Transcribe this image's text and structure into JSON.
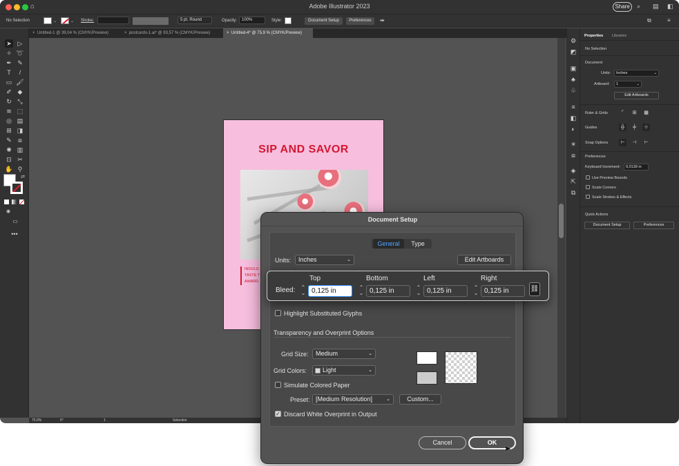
{
  "window": {
    "title": "Adobe Illustrator 2023",
    "share_label": "Share"
  },
  "control_bar": {
    "selection": "No Selection",
    "stroke_label": "Stroke:",
    "brush": "5 pt. Round",
    "opacity_label": "Opacity:",
    "opacity_value": "100%",
    "style_label": "Style:",
    "document_setup": "Document Setup",
    "preferences": "Preferences"
  },
  "doc_tabs": [
    {
      "label": "Untitled-1 @ 39,04 % (CMYK/Preview)"
    },
    {
      "label": "postcards-1.ai* @ 93,57 % (CMYK/Preview)"
    },
    {
      "label": "Untitled-4* @ 75,9 % (CMYK/Preview)"
    }
  ],
  "artboard": {
    "title": "SIP AND SAVOR",
    "text_lines": [
      "INDULG",
      "TASTE T",
      "AWARD"
    ]
  },
  "status_bar": {
    "zoom": "75,9%",
    "rotation": "0°",
    "page": "1",
    "tool": "Selection"
  },
  "properties": {
    "tabs": [
      "Properties",
      "Libraries"
    ],
    "no_selection": "No Selection",
    "document_heading": "Document",
    "units_label": "Units:",
    "units_value": "Inches",
    "artboard_label": "Artboard:",
    "artboard_value": "1",
    "edit_artboards": "Edit Artboards",
    "ruler_grids": "Ruler & Grids",
    "guides": "Guides",
    "snap_options": "Snap Options",
    "preferences_heading": "Preferences",
    "keyboard_increment_label": "Keyboard Increment:",
    "keyboard_increment_value": "0,0139 in",
    "use_preview_bounds": "Use Preview Bounds",
    "scale_corners": "Scale Corners",
    "scale_strokes": "Scale Strokes & Effects",
    "quick_actions": "Quick Actions",
    "qa_document_setup": "Document Setup",
    "qa_preferences": "Preferences"
  },
  "dialog": {
    "title": "Document Setup",
    "tab_general": "General",
    "tab_type": "Type",
    "units_label": "Units:",
    "units_value": "Inches",
    "edit_artboards": "Edit Artboards",
    "bleed_label": "Bleed:",
    "bleed": {
      "top_label": "Top",
      "top": "0,125 in",
      "bottom_label": "Bottom",
      "bottom": "0,125 in",
      "left_label": "Left",
      "left": "0,125 in",
      "right_label": "Right",
      "right": "0,125 in"
    },
    "highlight_glyphs": "Highlight Substituted Glyphs",
    "transparency_heading": "Transparency and Overprint Options",
    "grid_size_label": "Grid Size:",
    "grid_size_value": "Medium",
    "grid_colors_label": "Grid Colors:",
    "grid_colors_value": "Light",
    "simulate_paper": "Simulate Colored Paper",
    "preset_label": "Preset:",
    "preset_value": "[Medium Resolution]",
    "custom_button": "Custom...",
    "discard_overprint": "Discard White Overprint in Output",
    "discard_overprint_checked": true,
    "cancel": "Cancel",
    "ok": "OK"
  },
  "colors": {
    "accent": "#d3162f",
    "artboard_bg": "#f7bede",
    "tab_selected": "#52a7ff"
  }
}
